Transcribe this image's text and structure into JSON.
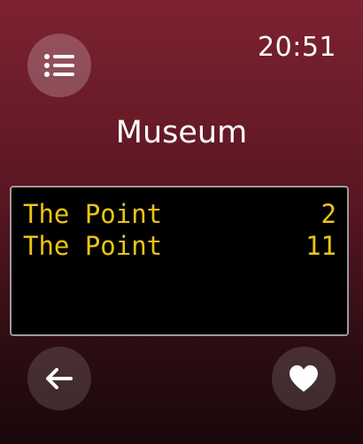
{
  "status": {
    "time": "20:51"
  },
  "header": {
    "title": "Museum",
    "menu_icon": "list-icon"
  },
  "departures": [
    {
      "destination": "The Point",
      "minutes": "2"
    },
    {
      "destination": "The Point",
      "minutes": "11"
    }
  ],
  "footer": {
    "back_icon": "arrow-left-icon",
    "favorite_icon": "heart-icon"
  },
  "colors": {
    "background_top": "#7d2230",
    "background_bottom": "#1a080b",
    "board_text": "#e9c516",
    "board_background": "#000000",
    "board_border": "#9a9a9a"
  }
}
